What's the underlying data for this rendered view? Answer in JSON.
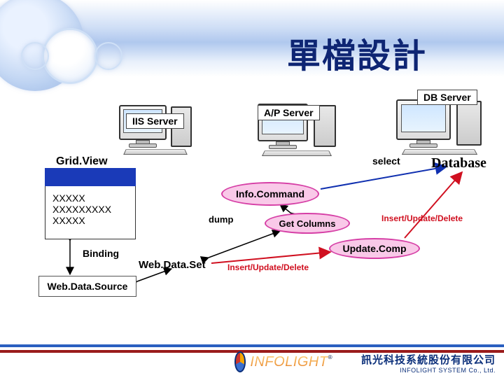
{
  "title": "單檔設計",
  "servers": {
    "iis": "IIS Server",
    "ap": "A/P Server",
    "db": "DB Server"
  },
  "gridview": {
    "label": "Grid.View",
    "rows": [
      "XXXXX",
      "XXXXXXXXX",
      "XXXXX"
    ]
  },
  "binding_label": "Binding",
  "webdatasource_label": "Web.Data.Source",
  "webdataset_label": "Web.Data.Set",
  "ovals": {
    "infocommand": "Info.Command",
    "getcolumns": "Get Columns",
    "updatecomp": "Update.Comp"
  },
  "labels": {
    "dump": "dump",
    "select": "select",
    "iud": "Insert/Update/Delete",
    "database": "Database"
  },
  "footer": {
    "brand": "INFOLIGHT",
    "company_cn": "訊光科技系統股份有限公司",
    "company_en": "INFOLIGHT SYSTEM Co., Ltd."
  }
}
